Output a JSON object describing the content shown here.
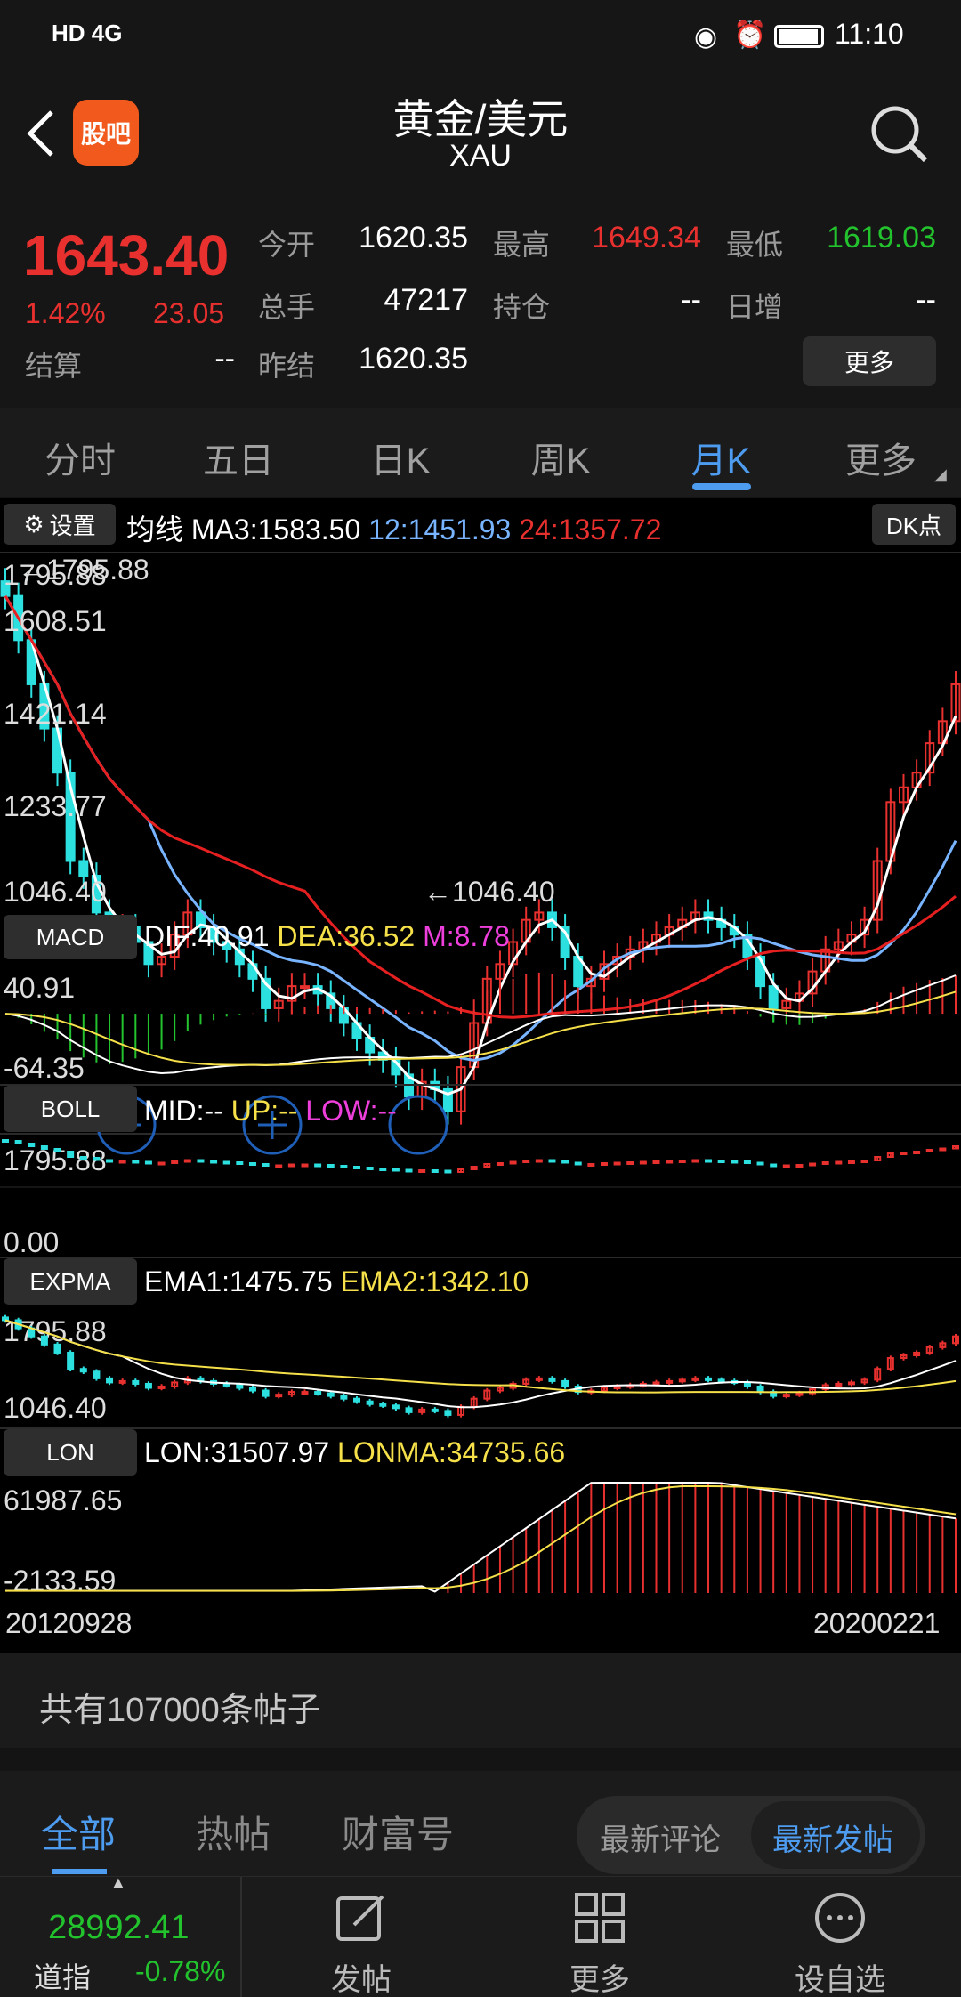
{
  "status_bar": {
    "network": "HD 4G",
    "time": "11:10"
  },
  "header": {
    "logo_text": "股吧",
    "title": "黄金/美元",
    "subtitle": "XAU"
  },
  "quote": {
    "price": "1643.40",
    "change_pct": "1.42%",
    "change": "23.05",
    "settle_label": "结算",
    "settle_value": "--",
    "open_label": "今开",
    "open_value": "1620.35",
    "high_label": "最高",
    "high_value": "1649.34",
    "low_label": "最低",
    "low_value": "1619.03",
    "volume_label": "总手",
    "volume_value": "47217",
    "position_label": "持仓",
    "position_value": "--",
    "daily_inc_label": "日增",
    "daily_inc_value": "--",
    "prev_settle_label": "昨结",
    "prev_settle_value": "1620.35",
    "more_label": "更多"
  },
  "tabs": [
    "分时",
    "五日",
    "日K",
    "周K",
    "月K",
    "更多"
  ],
  "active_tab": "月K",
  "chart": {
    "settings_label": "设置",
    "ma_label": "均线",
    "ma3": "MA3:1583.50",
    "ma12": "12:1451.93",
    "ma24": "24:1357.72",
    "dk_label": "DK点",
    "price_ticks": [
      "1795.88",
      "1608.51",
      "1421.14",
      "1233.77",
      "1046.40"
    ],
    "max_mark": "1795.88",
    "min_mark": "1046.40",
    "macd": {
      "name": "MACD",
      "dif": "DIF:40.91",
      "dea": "DEA:36.52",
      "m": "M:8.78",
      "top": "40.91",
      "bottom": "-64.35"
    },
    "boll": {
      "name": "BOLL",
      "mid": "MID:--",
      "up": "UP:--",
      "low": "LOW:--",
      "top": "1795.88",
      "bottom": "0.00"
    },
    "expma": {
      "name": "EXPMA",
      "ema1": "EMA1:1475.75",
      "ema2": "EMA2:1342.10",
      "top": "1795.88",
      "bottom": "1046.40"
    },
    "lon": {
      "name": "LON",
      "lon": "LON:31507.97",
      "lonma": "LONMA:34735.66",
      "top": "61987.65",
      "bottom": "-2133.59"
    },
    "date_start": "20120928",
    "date_end": "20200221"
  },
  "chart_data": {
    "type": "candlestick",
    "period": "monthly",
    "x_range": [
      "20120928",
      "20200221"
    ],
    "ylim": [
      1046.4,
      1795.88
    ],
    "ma": {
      "MA3": 1583.5,
      "MA12": 1451.93,
      "MA24": 1357.72
    },
    "series": [
      {
        "name": "MA3",
        "values_latest": 1583.5
      },
      {
        "name": "12",
        "values_latest": 1451.93
      },
      {
        "name": "24",
        "values_latest": 1357.72
      }
    ],
    "close_path": [
      1760,
      1700,
      1640,
      1580,
      1520,
      1400,
      1380,
      1330,
      1300,
      1310,
      1290,
      1260,
      1270,
      1300,
      1330,
      1310,
      1290,
      1280,
      1260,
      1240,
      1200,
      1210,
      1230,
      1230,
      1220,
      1200,
      1180,
      1160,
      1140,
      1130,
      1110,
      1080,
      1100,
      1090,
      1060,
      1120,
      1180,
      1240,
      1260,
      1290,
      1320,
      1330,
      1310,
      1270,
      1230,
      1240,
      1260,
      1270,
      1280,
      1290,
      1300,
      1310,
      1320,
      1330,
      1320,
      1310,
      1300,
      1270,
      1230,
      1200,
      1210,
      1220,
      1250,
      1280,
      1290,
      1300,
      1320,
      1400,
      1480,
      1500,
      1520,
      1560,
      1590,
      1640
    ]
  },
  "posts": {
    "count_text": "共有107000条帖子"
  },
  "post_tabs": [
    "全部",
    "热帖",
    "财富号"
  ],
  "active_post_tab": "全部",
  "sort_options": [
    "最新评论",
    "最新发帖"
  ],
  "active_sort": "最新发帖",
  "bottom_nav": {
    "index_value": "28992.41",
    "index_name": "道指",
    "index_change": "-0.78%",
    "post": "发帖",
    "more": "更多",
    "watchlist": "设自选"
  },
  "colors": {
    "up": "#e8312f",
    "down": "#23c32e",
    "accent": "#4d9cf0",
    "ma12": "#78b4ff",
    "ma24": "#e62020",
    "dea": "#f5e04a",
    "candle_down": "#2de0e0"
  }
}
